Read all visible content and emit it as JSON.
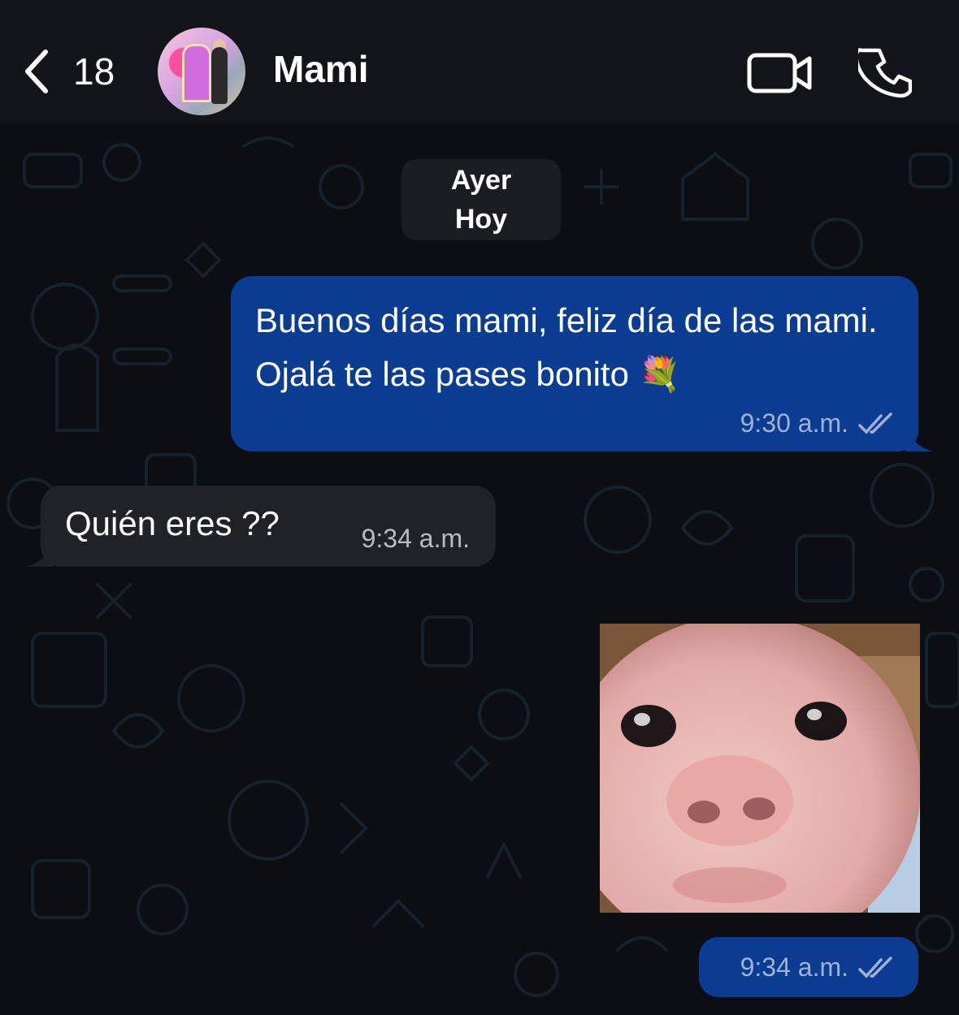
{
  "header": {
    "back_count": "18",
    "contact_name": "Mami",
    "icons": [
      "chevron-left-icon",
      "video-camera-icon",
      "phone-icon"
    ]
  },
  "date_chip": {
    "line1": "Ayer",
    "line2": "Hoy"
  },
  "messages": [
    {
      "direction": "outgoing",
      "text": "Buenos días mami, feliz día de las mami. Ojalá te las pases bonito 💐",
      "time": "9:30 a.m.",
      "status": "read"
    },
    {
      "direction": "incoming",
      "text": "Quién eres ??",
      "time": "9:34 a.m."
    },
    {
      "direction": "outgoing",
      "type": "image",
      "time": "9:34 a.m.",
      "status": "read"
    }
  ],
  "colors": {
    "background": "#0b0f14",
    "header": "#111418",
    "outgoing_bubble": "#0a3d91",
    "incoming_bubble": "#1f2226"
  }
}
